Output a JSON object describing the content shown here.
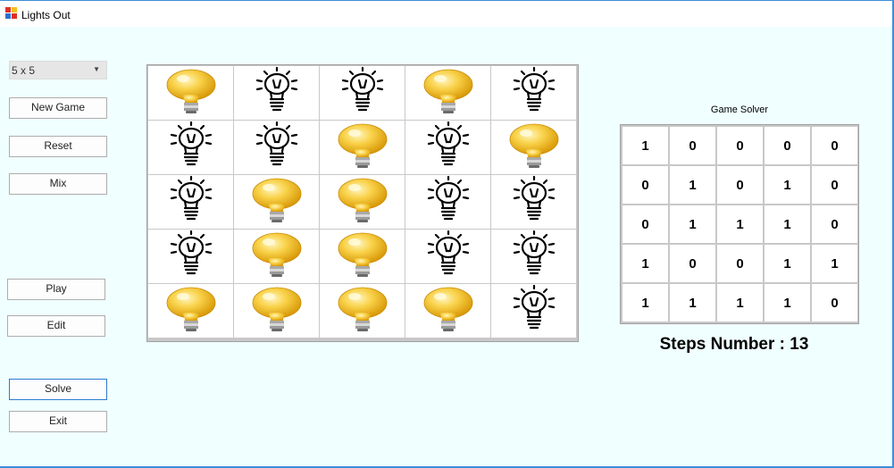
{
  "window": {
    "title": "Lights Out"
  },
  "controls": {
    "size_select": "5 x 5",
    "new_game": "New Game",
    "reset": "Reset",
    "mix": "Mix",
    "play": "Play",
    "edit": "Edit",
    "solve": "Solve",
    "exit": "Exit"
  },
  "board": {
    "rows": 5,
    "cols": 5,
    "cells": [
      [
        1,
        0,
        0,
        1,
        0
      ],
      [
        0,
        0,
        1,
        0,
        1
      ],
      [
        0,
        1,
        1,
        0,
        0
      ],
      [
        0,
        1,
        1,
        0,
        0
      ],
      [
        1,
        1,
        1,
        1,
        0
      ]
    ],
    "icon_on": "lit-bulb-icon",
    "icon_off": "unlit-bulb-icon"
  },
  "solver": {
    "title": "Game Solver",
    "cells": [
      [
        "1",
        "0",
        "0",
        "0",
        "0"
      ],
      [
        "0",
        "1",
        "0",
        "1",
        "0"
      ],
      [
        "0",
        "1",
        "1",
        "1",
        "0"
      ],
      [
        "1",
        "0",
        "0",
        "1",
        "1"
      ],
      [
        "1",
        "1",
        "1",
        "1",
        "0"
      ]
    ]
  },
  "steps": {
    "text": "Steps Number : 13"
  },
  "colors": {
    "background": "#f0ffff",
    "bulb_on": "#f7c21a",
    "bulb_off_line": "#000000"
  }
}
